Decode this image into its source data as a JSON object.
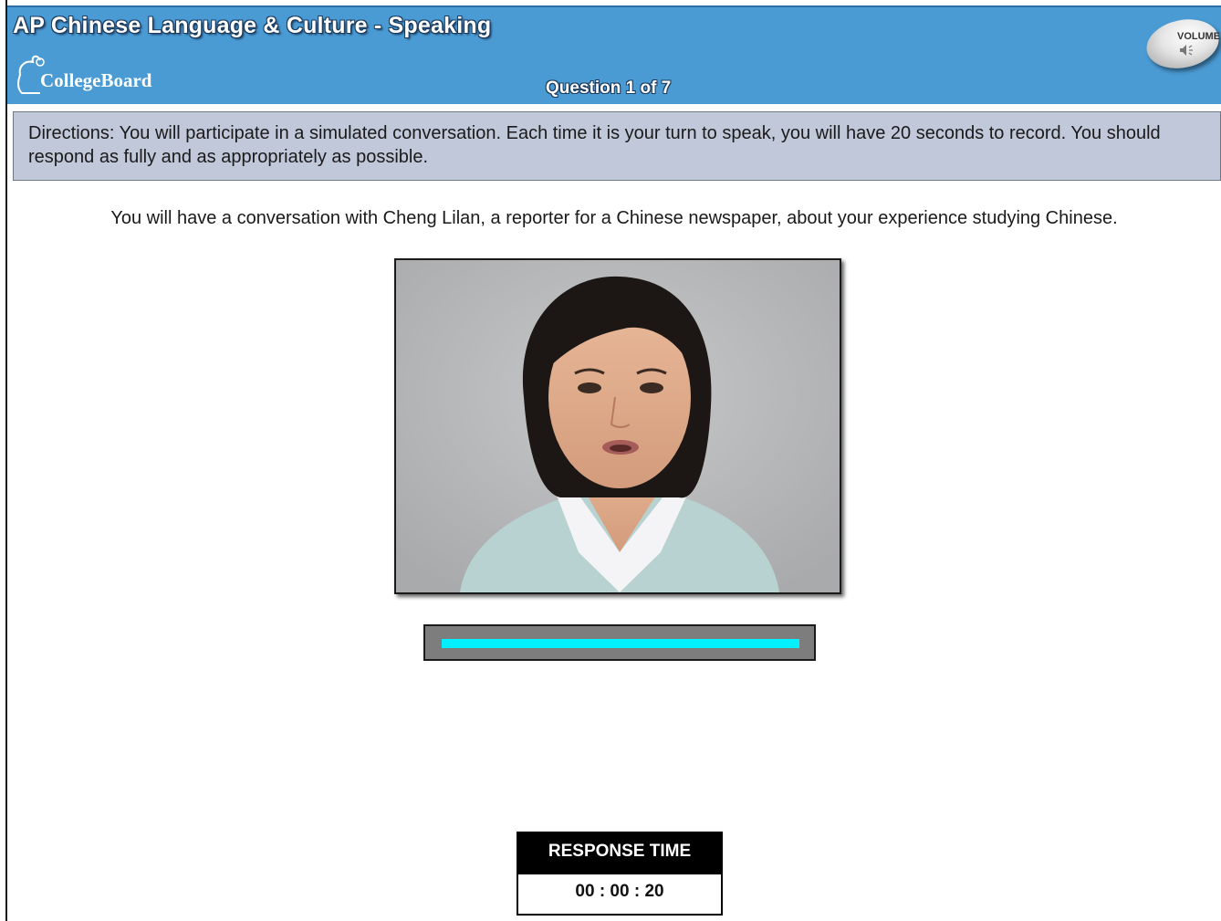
{
  "app": {
    "title": "AP Chinese Language & Culture  -  Speaking",
    "logo_text": "CollegeBoard",
    "question_indicator": "Question 1 of 7",
    "volume_label": "VOLUME"
  },
  "directions": {
    "text": "Directions: You will participate in a simulated conversation. Each time it is your turn to speak, you will have 20 seconds to record. You should respond as fully and as appropriately as possible."
  },
  "prompt": {
    "text": "You will have a conversation with Cheng Lilan, a reporter for a Chinese newspaper, about your experience studying Chinese."
  },
  "progress": {
    "fraction": 1.0
  },
  "timer": {
    "label": "RESPONSE TIME",
    "value": "00 : 00 : 20"
  },
  "icons": {
    "logo": "collegeboard-logo-icon",
    "volume": "speaker-icon"
  },
  "colors": {
    "header_bg": "#4a9ad3",
    "directions_bg": "#c1c8d9",
    "progress_fill": "#00f0ff",
    "timer_head_bg": "#000000"
  }
}
